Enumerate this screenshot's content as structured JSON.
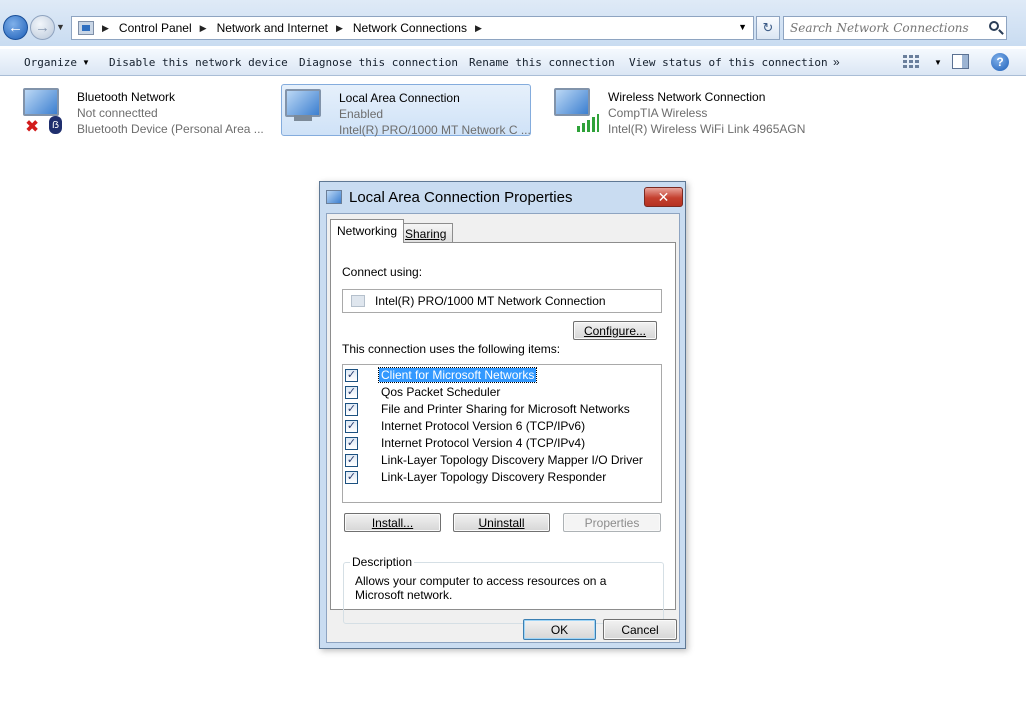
{
  "address_bar": {
    "breadcrumbs": [
      "Control Panel",
      "Network and Internet",
      "Network Connections"
    ],
    "search_placeholder": "Search Network Connections"
  },
  "toolbar": {
    "organize": "Organize",
    "disable": "Disable this network device",
    "diagnose": "Diagnose this connection",
    "rename": "Rename this connection",
    "view_status": "View status of this connection",
    "more": "»",
    "help": "?"
  },
  "connections": [
    {
      "name": "Bluetooth Network",
      "status": "Not connectted",
      "device": "Bluetooth Device (Personal Area ..."
    },
    {
      "name": "Local Area Connection",
      "status": "Enabled",
      "device": "Intel(R) PRO/1000 MT Network C ..."
    },
    {
      "name": "Wireless Network Connection",
      "status": "CompTIA Wireless",
      "device": "Intel(R) Wireless WiFi Link 4965AGN"
    }
  ],
  "dialog": {
    "title": "Local Area Connection Properties",
    "close": "✕",
    "tabs": [
      "Networking",
      "Sharing"
    ],
    "connect_using_label": "Connect using:",
    "adapter": "Intel(R) PRO/1000 MT Network Connection",
    "configure": "Configure...",
    "items_label": "This connection uses the following items:",
    "items": [
      {
        "label": "Client for Microsoft Networks",
        "checked": true,
        "selected": true
      },
      {
        "label": "Qos Packet Scheduler",
        "checked": true,
        "selected": false
      },
      {
        "label": "File and Printer Sharing for Microsoft Networks",
        "checked": true,
        "selected": false
      },
      {
        "label": "Internet Protocol Version 6 (TCP/IPv6)",
        "checked": true,
        "selected": false
      },
      {
        "label": "Internet Protocol Version 4 (TCP/IPv4)",
        "checked": true,
        "selected": false
      },
      {
        "label": "Link-Layer Topology Discovery Mapper I/O Driver",
        "checked": true,
        "selected": false
      },
      {
        "label": "Link-Layer Topology Discovery Responder",
        "checked": true,
        "selected": false
      }
    ],
    "install": "Install...",
    "uninstall": "Uninstall",
    "properties": "Properties",
    "description_label": "Description",
    "description": "Allows your computer to access resources on a Microsoft network.",
    "ok": "OK",
    "cancel": "Cancel"
  },
  "icons": {
    "back": "back-arrow-icon",
    "forward": "forward-arrow-icon",
    "search": "search-icon",
    "help": "help-icon",
    "close": "close-icon"
  }
}
